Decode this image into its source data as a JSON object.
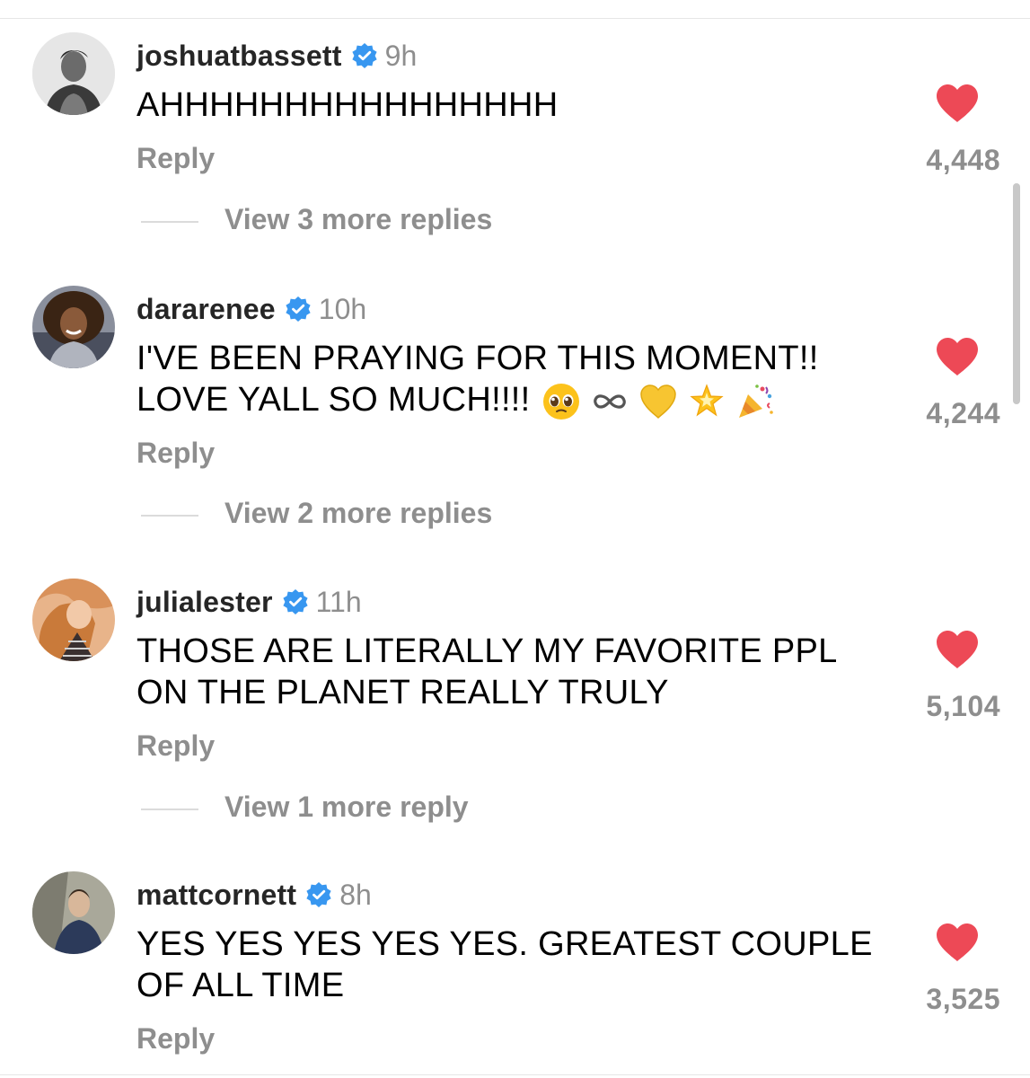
{
  "comments": [
    {
      "username": "joshuatbassett",
      "time": "9h",
      "text": "AHHHHHHHHHHHHHHHH",
      "reply_label": "Reply",
      "likes": "4,448",
      "view_replies": "View 3 more replies"
    },
    {
      "username": "dararenee",
      "time": "10h",
      "text_line1": "I'VE BEEN PRAYING FOR THIS MOMENT!!",
      "text_line2": "LOVE YALL SO MUCH!!!!",
      "emojis": [
        "pleading-face",
        "infinity",
        "yellow-heart",
        "glowing-star",
        "party-popper"
      ],
      "reply_label": "Reply",
      "likes": "4,244",
      "view_replies": "View 2 more replies"
    },
    {
      "username": "julialester",
      "time": "11h",
      "text_line1": "THOSE ARE LITERALLY MY FAVORITE PPL",
      "text_line2": "ON THE PLANET REALLY TRULY",
      "reply_label": "Reply",
      "likes": "5,104",
      "view_replies": "View 1 more reply"
    },
    {
      "username": "mattcornett",
      "time": "8h",
      "text_line1": "YES YES YES YES YES. GREATEST COUPLE",
      "text_line2": "OF ALL TIME",
      "reply_label": "Reply",
      "likes": "3,525"
    }
  ],
  "colors": {
    "heart": "#ed4956",
    "verified": "#3897f0",
    "secondary_text": "#8e8e8e"
  }
}
